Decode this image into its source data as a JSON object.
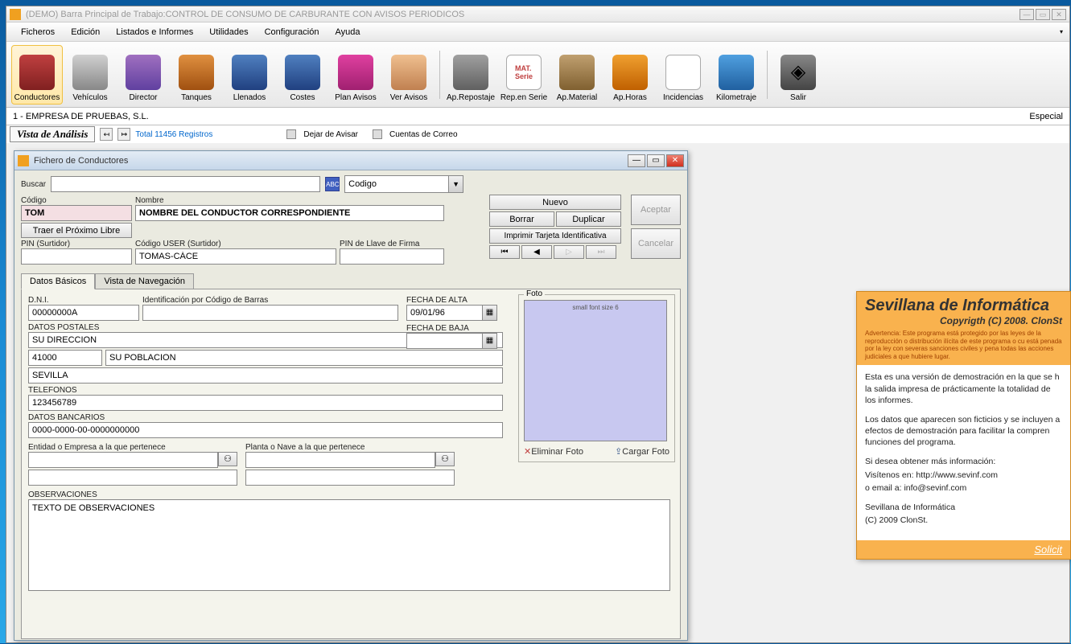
{
  "main": {
    "title": "(DEMO) Barra Principal de Trabajo:CONTROL DE CONSUMO DE CARBURANTE CON AVISOS PERIODICOS",
    "menus": [
      "Ficheros",
      "Edición",
      "Listados e Informes",
      "Utilidades",
      "Configuración",
      "Ayuda"
    ],
    "toolbar": [
      {
        "label": "Conductores"
      },
      {
        "label": "Vehículos"
      },
      {
        "label": "Director"
      },
      {
        "label": "Tanques"
      },
      {
        "label": "Llenados"
      },
      {
        "label": "Costes"
      },
      {
        "label": "Plan Avisos"
      },
      {
        "label": "Ver Avisos"
      },
      {
        "label": "Ap.Repostaje"
      },
      {
        "label": "Rep.en Serie"
      },
      {
        "label": "Ap.Material"
      },
      {
        "label": "Ap.Horas"
      },
      {
        "label": "Incidencias"
      },
      {
        "label": "Kilometraje"
      },
      {
        "label": "Salir"
      }
    ],
    "company": "1  -  EMPRESA DE PRUEBAS, S.L.",
    "especial": "Especial",
    "vista": "Vista de Análisis",
    "total": "Total 11456 Registros",
    "dejar": "Dejar de Avisar",
    "cuentas": "Cuentas de Correo"
  },
  "dialog": {
    "title": "Fichero de Conductores",
    "buscar_label": "Buscar",
    "combo_value": "Codigo",
    "codigo_label": "Código",
    "codigo_value": "TOM",
    "nombre_label": "Nombre",
    "nombre_value": "NOMBRE DEL CONDUCTOR CORRESPONDIENTE",
    "traer_btn": "Traer el Próximo Libre",
    "pin_surt_label": "PIN (Surtidor)",
    "pin_surt_value": "",
    "cod_user_label": "Código USER (Surtidor)",
    "cod_user_value": "TOMAS-CÁCE",
    "pin_firma_label": "PIN de Llave de Firma",
    "pin_firma_value": "",
    "nuevo": "Nuevo",
    "borrar": "Borrar",
    "duplicar": "Duplicar",
    "imprimir": "Imprimir Tarjeta Identificativa",
    "aceptar": "Aceptar",
    "cancelar": "Cancelar",
    "tabs": [
      "Datos Básicos",
      "Vista de Navegación"
    ],
    "dni_label": "D.N.I.",
    "dni_value": "00000000A",
    "ident_label": "Identificación por Código de Barras",
    "ident_value": "",
    "postales_label": "DATOS POSTALES",
    "direccion": "SU DIRECCION",
    "cp": "41000",
    "poblacion": "SU POBLACION",
    "provincia": "SEVILLA",
    "tel_label": "TELEFONOS",
    "tel_value": "123456789",
    "banc_label": "DATOS BANCARIOS",
    "banc_value": "0000-0000-00-0000000000",
    "entidad_label": "Entidad o Empresa a la que pertenece",
    "planta_label": "Planta o Nave a la que pertenece",
    "obs_label": "OBSERVACIONES",
    "obs_value": "TEXTO DE OBSERVACIONES",
    "alta_label": "FECHA DE ALTA",
    "alta_value": "09/01/96",
    "baja_label": "FECHA DE BAJA",
    "baja_value": "",
    "foto_label": "Foto",
    "foto_hint": "small font size 6",
    "eliminar_foto": "Eliminar Foto",
    "cargar_foto": "Cargar Foto"
  },
  "popup": {
    "title": "Sevillana de Informática",
    "sub": "Copyrigth (C) 2008. ClonSt",
    "warn": "Advertencia: Este programa está protegido por las leyes de la reproducción o distribución ilícita de este programa o cu está penada por la ley con severas sanciones civiles y pena todas las acciones judiciales a que hubiere lugar.",
    "p1": "Esta es una versión de demostración en la que se h la salida impresa de prácticamente la totalidad de los informes.",
    "p2": "Los datos que aparecen son ficticios y se incluyen a efectos de demostración para facilitar la compren funciones del programa.",
    "p3": "Si desea obtener más información:",
    "p4": "Visítenos en: http://www.sevinf.com",
    "p5": "o email a: info@sevinf.com",
    "p6": "Sevillana de Informática",
    "p7": "(C) 2009 ClonSt.",
    "solicit": "Solicit"
  }
}
